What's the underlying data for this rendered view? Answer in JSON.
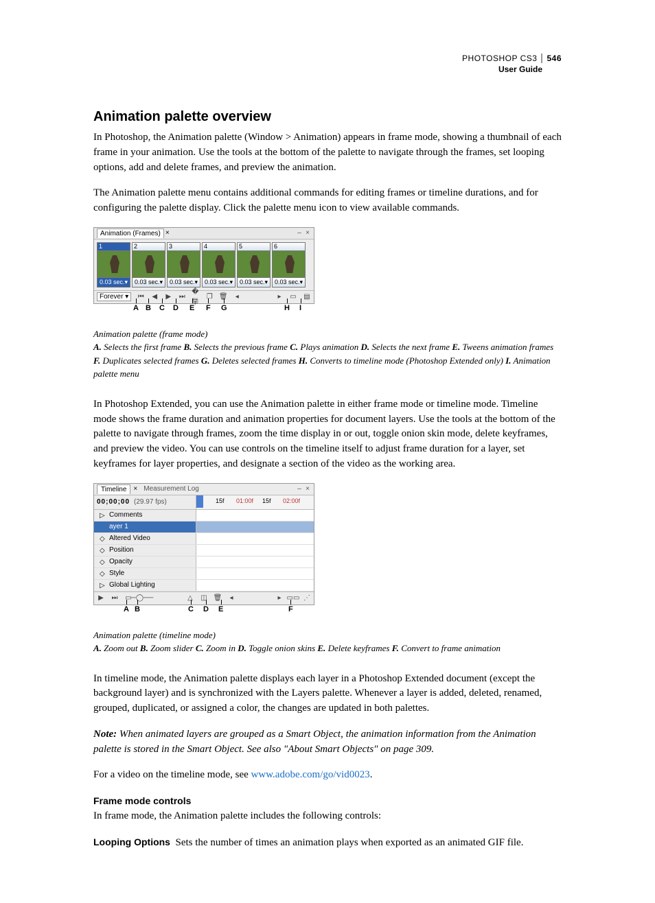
{
  "header": {
    "product": "PHOTOSHOP CS3",
    "guide": "User Guide",
    "page": "546"
  },
  "h1": "Animation palette overview",
  "p1": "In Photoshop, the Animation palette (Window > Animation) appears in frame mode, showing a thumbnail of each frame in your animation. Use the tools at the bottom of the palette to navigate through the frames, set looping options, add and delete frames, and preview the animation.",
  "p2": "The Animation palette menu contains additional commands for editing frames or timeline durations, and for configuring the palette display. Click the palette menu icon to view available commands.",
  "fig1": {
    "tab": "Animation (Frames)",
    "frames": [
      {
        "n": "1",
        "t": "0.03 sec."
      },
      {
        "n": "2",
        "t": "0.03 sec."
      },
      {
        "n": "3",
        "t": "0.03 sec."
      },
      {
        "n": "4",
        "t": "0.03 sec."
      },
      {
        "n": "5",
        "t": "0.03 sec."
      },
      {
        "n": "6",
        "t": "0.03 sec."
      }
    ],
    "loop": "Forever",
    "ticks": [
      "A",
      "B",
      "C",
      "D",
      "E",
      "F",
      "G",
      "H",
      "I"
    ],
    "caption_title": "Animation palette (frame mode)",
    "legend": [
      {
        "l": "A.",
        "t": "Selects the first frame"
      },
      {
        "l": "B.",
        "t": "Selects the previous frame"
      },
      {
        "l": "C.",
        "t": "Plays animation"
      },
      {
        "l": "D.",
        "t": "Selects the next frame"
      },
      {
        "l": "E.",
        "t": "Tweens animation frames"
      },
      {
        "l": "F.",
        "t": "Duplicates selected frames"
      },
      {
        "l": "G.",
        "t": "Deletes selected frames"
      },
      {
        "l": "H.",
        "t": "Converts to timeline mode (Photoshop Extended only)"
      },
      {
        "l": "I.",
        "t": "Animation palette menu"
      }
    ]
  },
  "p3": "In Photoshop Extended, you can use the Animation palette in either frame mode or timeline mode. Timeline mode shows the frame duration and animation properties for document layers. Use the tools at the bottom of the palette to navigate through frames, zoom the time display in or out, toggle onion skin mode, delete keyframes, and preview the video. You can use controls on the timeline itself to adjust frame duration for a layer, set keyframes for layer properties, and designate a section of the video as the working area.",
  "fig2": {
    "tab1": "Timeline",
    "tab2": "Measurement Log",
    "timecode": "00;00;00",
    "fps": "(29.97 fps)",
    "ruler": [
      "15f",
      "01:00f",
      "15f",
      "02:00f"
    ],
    "rows": [
      "Comments",
      "ayer 1",
      "Altered Video",
      "Position",
      "Opacity",
      "Style",
      "Global Lighting"
    ],
    "ticks": [
      "A",
      "B",
      "C",
      "D",
      "E",
      "F"
    ],
    "caption_title": "Animation palette (timeline mode)",
    "legend": [
      {
        "l": "A.",
        "t": "Zoom out"
      },
      {
        "l": "B.",
        "t": "Zoom slider"
      },
      {
        "l": "C.",
        "t": "Zoom in"
      },
      {
        "l": "D.",
        "t": "Toggle onion skins"
      },
      {
        "l": "E.",
        "t": "Delete keyframes"
      },
      {
        "l": "F.",
        "t": "Convert to frame animation"
      }
    ]
  },
  "p4": "In timeline mode, the Animation palette displays each layer in a Photoshop Extended document (except the background layer) and is synchronized with the Layers palette. Whenever a layer is added, deleted, renamed, grouped, duplicated, or assigned a color, the changes are updated in both palettes.",
  "note_label": "Note:",
  "note": "When animated layers are grouped as a Smart Object, the animation information from the Animation palette is stored in the Smart Object. See also \"About Smart Objects\" on page 309.",
  "p5a": "For a video on the timeline mode, see ",
  "link": "www.adobe.com/go/vid0023",
  "p5b": ".",
  "sub1": "Frame mode controls",
  "p6": "In frame mode, the Animation palette includes the following controls:",
  "opt1_label": "Looping Options",
  "opt1_text": "Sets the number of times an animation plays when exported as an animated GIF file."
}
